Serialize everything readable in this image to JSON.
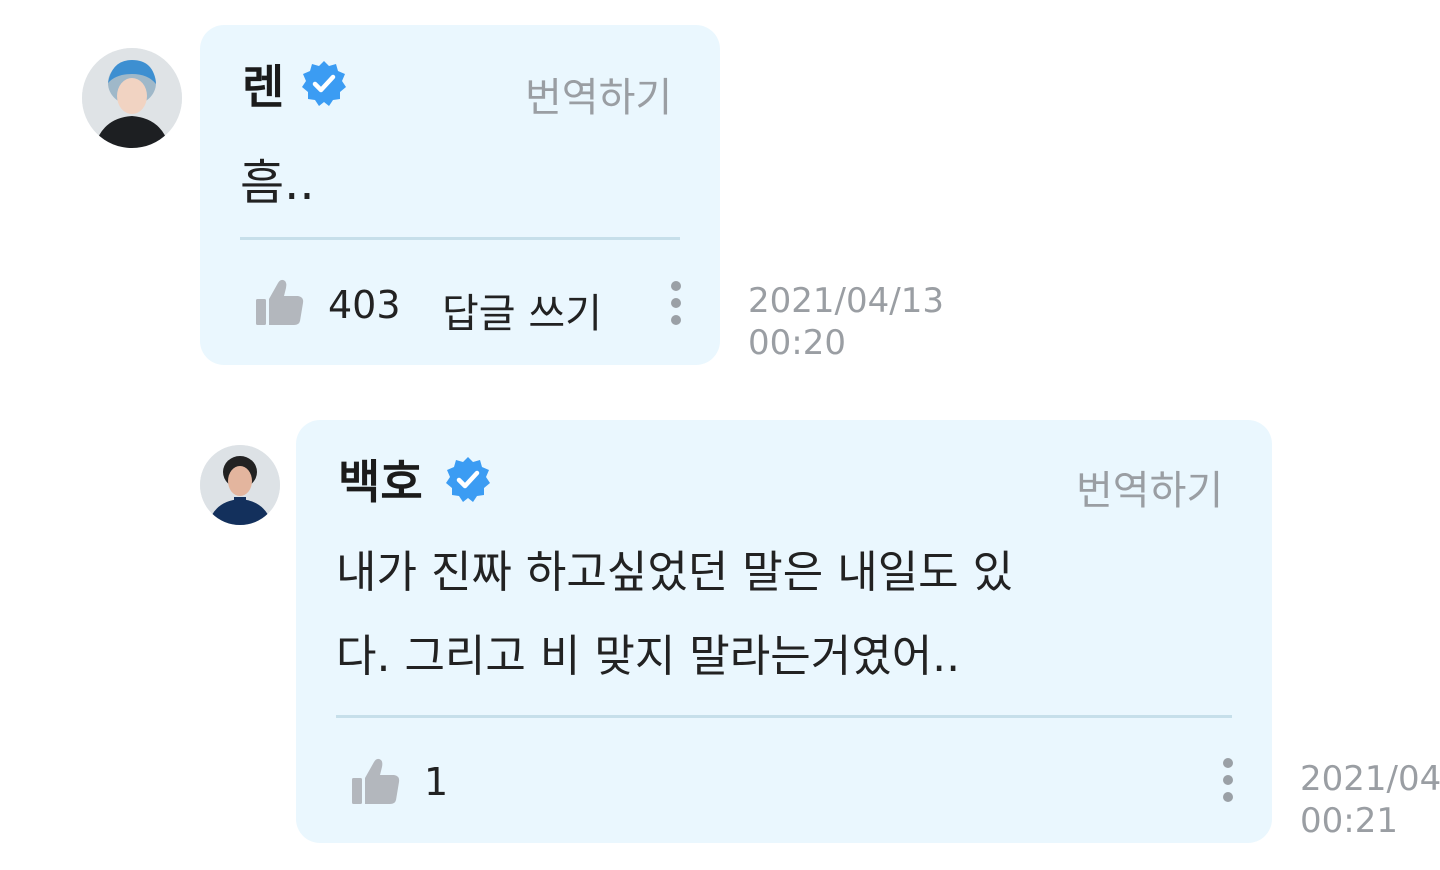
{
  "comments": [
    {
      "author": "렌",
      "verified": true,
      "translate_label": "번역하기",
      "text": "흠..",
      "likes": "403",
      "reply_label": "답글 쓰기",
      "date": "2021/04/13",
      "time": "00:20"
    },
    {
      "author": "백호",
      "verified": true,
      "translate_label": "번역하기",
      "text_line1": "내가 진짜 하고싶었던 말은 내일도 있",
      "text_line2": "다. 그리고 비 맞지 말라는거였어..",
      "likes": "1",
      "date": "2021/04/",
      "time": "00:21"
    }
  ],
  "colors": {
    "bubble": "#eaf7fe",
    "verified_badge": "#3b9cf3",
    "muted_text": "#9a9ea3",
    "thumb": "#b3b7bd"
  },
  "icons": [
    "verified-badge-icon",
    "thumbs-up-icon",
    "more-vertical-icon",
    "avatar"
  ]
}
